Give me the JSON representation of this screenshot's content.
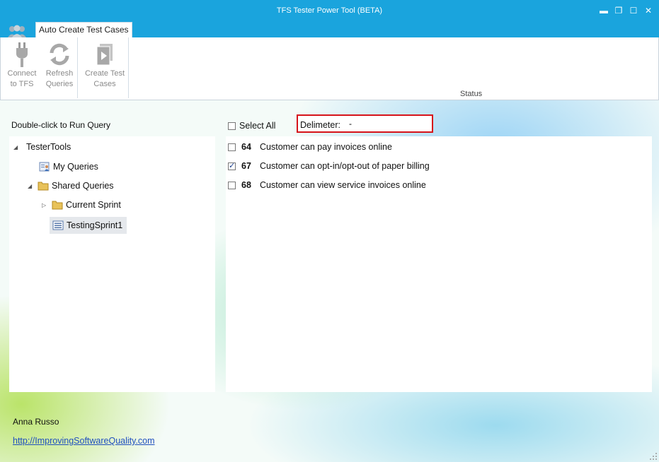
{
  "window": {
    "title": "TFS Tester Power Tool (BETA)",
    "controls": [
      "minimize-icon",
      "restore-icon",
      "maximize-icon",
      "close-icon"
    ]
  },
  "ribbon": {
    "tab": "Auto Create Test Cases",
    "buttons": {
      "connect": "Connect\nto TFS",
      "refresh": "Refresh\nQueries",
      "create": "Create Test\nCases"
    },
    "status_label": "Status"
  },
  "left": {
    "header": "Double-click to Run Query",
    "tree": [
      {
        "label": "TesterTools",
        "icon": "expanded-triangle"
      },
      {
        "label": "My Queries",
        "icon": "my-queries-icon"
      },
      {
        "label": "Shared Queries",
        "icon": "folder-icon"
      },
      {
        "label": "Current Sprint",
        "icon": "folder-icon"
      },
      {
        "label": "TestingSprint1",
        "icon": "query-list-icon"
      }
    ]
  },
  "right": {
    "select_all": "Select All",
    "delimiter_label": "Delimeter:",
    "delimiter_value": "-",
    "items": [
      {
        "id": "64",
        "title": "Customer can pay invoices online",
        "checked": false
      },
      {
        "id": "67",
        "title": "Customer can opt-in/opt-out of paper billing",
        "checked": true
      },
      {
        "id": "68",
        "title": "Customer can view service invoices online",
        "checked": false
      }
    ]
  },
  "footer": {
    "author": "Anna Russo",
    "link": "http://ImprovingSoftwareQuality.com"
  },
  "colors": {
    "titlebar": "#1aa4dd",
    "highlight_border": "#d6131a",
    "link": "#1f4fbf"
  }
}
